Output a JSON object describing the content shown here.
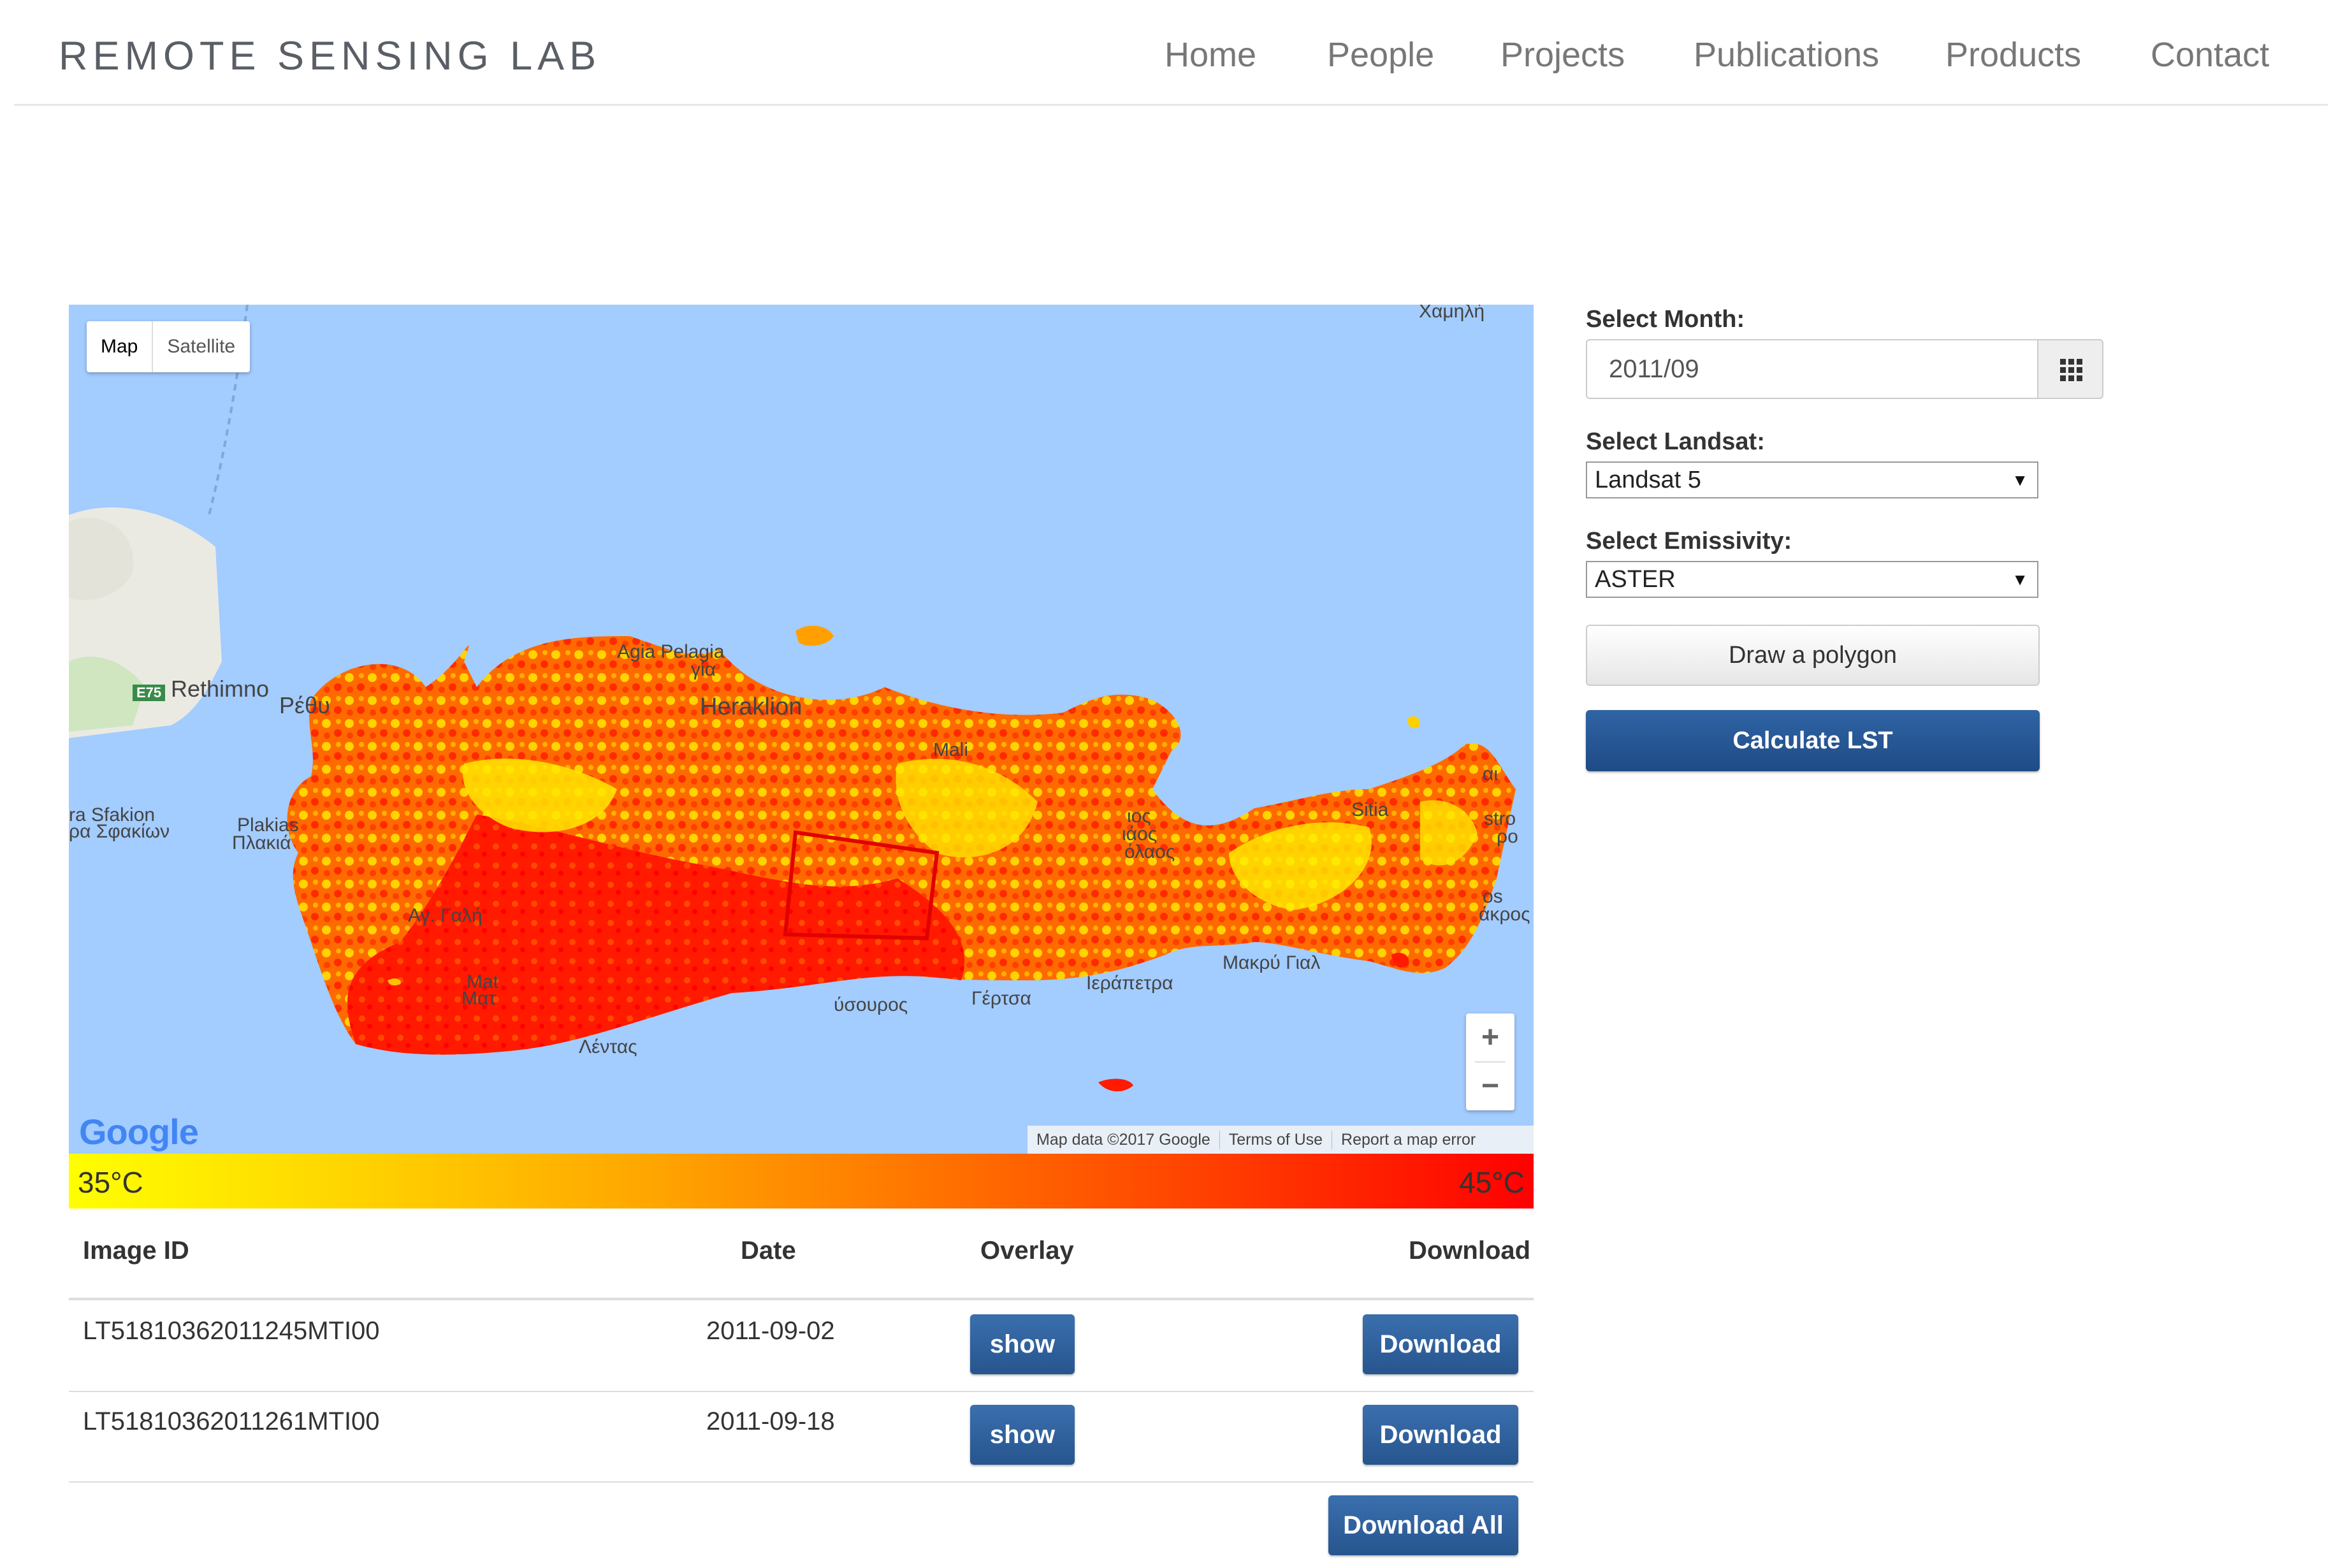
{
  "header": {
    "brand": "REMOTE SENSING LAB",
    "nav": [
      {
        "label": "Home"
      },
      {
        "label": "People"
      },
      {
        "label": "Projects"
      },
      {
        "label": "Publications"
      },
      {
        "label": "Products"
      },
      {
        "label": "Contact"
      }
    ]
  },
  "map": {
    "type_buttons": {
      "map": "Map",
      "satellite": "Satellite"
    },
    "labels": {
      "rethimno": "Rethimno",
      "rethimno_gr": "Ρέθυ",
      "heraklion": "Heraklion",
      "agia_pelagia": "Agia Pelagia",
      "agia_pelagia_gr": "γία",
      "sfakion": "ra Sfakion",
      "sfakion_gr": "ρα Σφακίων",
      "plakias": "Plakias",
      "plakias_gr": "Πλακιά",
      "agia_galini": "Αγ. Γαλή",
      "matala": "Mat",
      "matala_gr": "Ματ",
      "lentas": "Λέντας",
      "tsoutsouros": "ύσουρος",
      "gertas": "Γέρτσα",
      "ierapetra": "Ιεράπετρα",
      "makry_gialos": "Μακρύ Γιαλ",
      "malia": "Mali",
      "agios_nikolaos": "ιος",
      "agios_nikolaos_gr": "ιάος",
      "agios_nikolaos_gr2": "όλαος",
      "sitia": "Sitia",
      "chamili": "Χαμηλή",
      "zakros": "os",
      "zakros_gr": "άκρος",
      "palekastro": "stro",
      "palekastro_gr": "ρο",
      "kato": "αι",
      "road": "E75"
    },
    "zoom_in": "+",
    "zoom_out": "−",
    "logo": "Google",
    "attribution": [
      "Map data ©2017 Google",
      "Terms of Use",
      "Report a map error"
    ],
    "legend": {
      "min": "35°C",
      "max": "45°C",
      "colors": [
        "#ffff00",
        "#ffa500",
        "#ff5000",
        "#ff0000"
      ]
    }
  },
  "table": {
    "headers": {
      "image_id": "Image ID",
      "date": "Date",
      "overlay": "Overlay",
      "download": "Download"
    },
    "rows": [
      {
        "image_id": "LT51810362011245MTI00",
        "date": "2011-09-02",
        "overlay": "show",
        "download": "Download"
      },
      {
        "image_id": "LT51810362011261MTI00",
        "date": "2011-09-18",
        "overlay": "show",
        "download": "Download"
      }
    ],
    "download_all": "Download All"
  },
  "panel": {
    "month_label": "Select Month:",
    "month_value": "2011/09",
    "landsat_label": "Select Landsat:",
    "landsat_value": "Landsat 5",
    "emissivity_label": "Select Emissivity:",
    "emissivity_value": "ASTER",
    "draw_button": "Draw a polygon",
    "calc_button": "Calculate LST"
  },
  "colors": {
    "accent_button": "#27558e",
    "sea": "#a3ccff"
  }
}
